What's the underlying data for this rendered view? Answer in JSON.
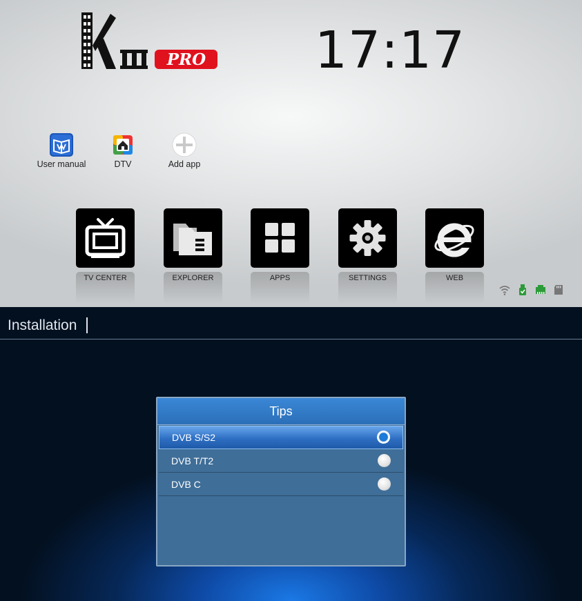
{
  "launcher": {
    "brand": {
      "mark": "K",
      "numeral": "III",
      "badge": "PRO"
    },
    "clock": "17:17",
    "shortcuts": [
      {
        "label": "User manual",
        "icon": "user-manual-icon"
      },
      {
        "label": "DTV",
        "icon": "dtv-icon"
      },
      {
        "label": "Add app",
        "icon": "add-icon"
      }
    ],
    "tiles": [
      {
        "label": "TV CENTER",
        "icon": "tv-icon"
      },
      {
        "label": "EXPLORER",
        "icon": "folder-icon"
      },
      {
        "label": "APPS",
        "icon": "apps-grid-icon"
      },
      {
        "label": "SETTINGS",
        "icon": "gear-icon"
      },
      {
        "label": "WEB",
        "icon": "browser-icon"
      }
    ],
    "status_icons": [
      "wifi-icon",
      "usb-icon",
      "ethernet-icon",
      "sd-card-icon"
    ]
  },
  "installation": {
    "title": "Installation",
    "dialog": {
      "title": "Tips",
      "options": [
        {
          "label": "DVB S/S2",
          "selected": true
        },
        {
          "label": "DVB T/T2",
          "selected": false
        },
        {
          "label": "DVB C",
          "selected": false
        }
      ]
    }
  },
  "colors": {
    "logo_red": "#e0121e",
    "highlight_blue": "#2e6fc4",
    "dialog_body": "#3f6e98",
    "status_green": "#2d9a3a"
  }
}
